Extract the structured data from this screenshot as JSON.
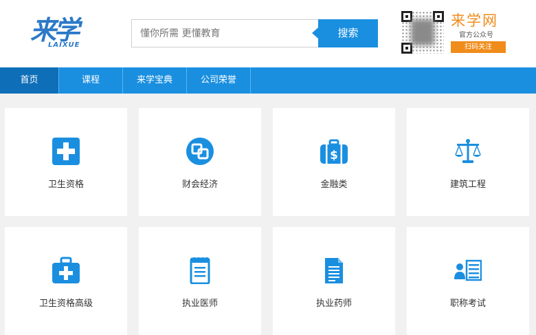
{
  "header": {
    "logo_main": "来学",
    "logo_sub": "LAIXUE",
    "search_placeholder": "懂你所需 更懂教育",
    "search_label": "搜索",
    "brand_title": "来学网",
    "brand_sub": "官方公众号",
    "brand_button": "扫码关注"
  },
  "nav": {
    "items": [
      {
        "label": "首页"
      },
      {
        "label": "课程"
      },
      {
        "label": "来学宝典"
      },
      {
        "label": "公司荣誉"
      }
    ]
  },
  "categories": [
    {
      "label": "卫生资格",
      "icon": "medical-cross-icon"
    },
    {
      "label": "财会经济",
      "icon": "finance-coins-icon"
    },
    {
      "label": "金融类",
      "icon": "money-bag-icon"
    },
    {
      "label": "建筑工程",
      "icon": "scales-icon"
    },
    {
      "label": "卫生资格高级",
      "icon": "medical-kit-icon"
    },
    {
      "label": "执业医师",
      "icon": "notepad-icon"
    },
    {
      "label": "执业药师",
      "icon": "document-icon"
    },
    {
      "label": "职称考试",
      "icon": "id-card-icon"
    }
  ],
  "colors": {
    "accent": "#1a8fe0",
    "brand_orange": "#f08c1a"
  }
}
